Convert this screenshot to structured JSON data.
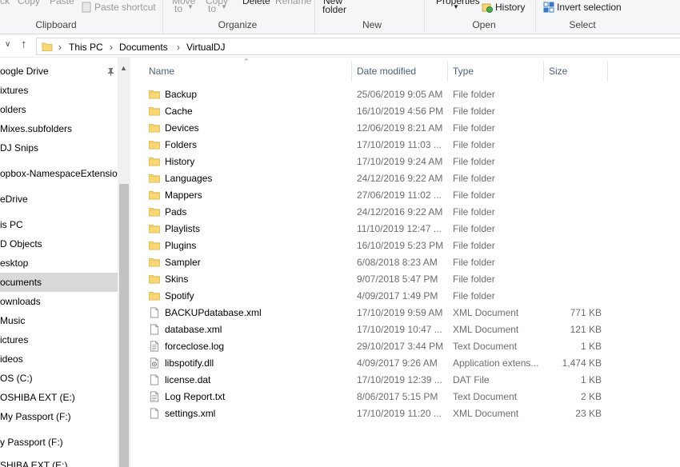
{
  "ribbon": {
    "cut_partial": "ck",
    "copy_partial": "Copy",
    "paste_partial": "Paste",
    "paste_shortcut": "Paste shortcut",
    "move_to": "Move",
    "move_to_2": "to",
    "copy_to": "Copy",
    "copy_to_2": "to",
    "delete_partial": "Delete",
    "rename_partial": "Rename",
    "new_folder_1": "New",
    "new_folder_2": "folder",
    "properties_partial": "Properties",
    "history": "History",
    "invert_selection": "Invert selection",
    "groups": {
      "clipboard": "Clipboard",
      "organize": "Organize",
      "new": "New",
      "open": "Open",
      "select": "Select"
    }
  },
  "address": {
    "crumbs": [
      "This PC",
      "Documents",
      "VirtualDJ"
    ]
  },
  "nav": {
    "items": [
      {
        "label": "oogle Drive",
        "selected": false
      },
      {
        "label": "ixtures",
        "selected": false
      },
      {
        "label": "olders",
        "selected": false
      },
      {
        "label": "Mixes.subfolders",
        "selected": false
      },
      {
        "label": "DJ Snips",
        "selected": false
      },
      {
        "label": "opbox-NamespaceExtension",
        "selected": false
      },
      {
        "label": "eDrive",
        "selected": false
      },
      {
        "label": "is PC",
        "selected": false
      },
      {
        "label": "D Objects",
        "selected": false
      },
      {
        "label": "esktop",
        "selected": false
      },
      {
        "label": "ocuments",
        "selected": true
      },
      {
        "label": "ownloads",
        "selected": false
      },
      {
        "label": "Music",
        "selected": false
      },
      {
        "label": "ictures",
        "selected": false
      },
      {
        "label": "ideos",
        "selected": false
      },
      {
        "label": "OS (C:)",
        "selected": false
      },
      {
        "label": "OSHIBA EXT (E:)",
        "selected": false
      },
      {
        "label": "My Passport (F:)",
        "selected": false
      },
      {
        "label": "y Passport (F:)",
        "selected": false
      },
      {
        "label": "SHIBA EXT (E:)",
        "selected": false
      }
    ]
  },
  "list": {
    "headers": {
      "name": "Name",
      "date": "Date modified",
      "type": "Type",
      "size": "Size"
    },
    "rows": [
      {
        "icon": "folder-icon",
        "name": "Backup",
        "date": "25/06/2019 9:05 AM",
        "type": "File folder",
        "size": ""
      },
      {
        "icon": "folder-icon",
        "name": "Cache",
        "date": "16/10/2019 4:56 PM",
        "type": "File folder",
        "size": ""
      },
      {
        "icon": "folder-icon",
        "name": "Devices",
        "date": "12/06/2019 8:21 AM",
        "type": "File folder",
        "size": ""
      },
      {
        "icon": "folder-icon",
        "name": "Folders",
        "date": "17/10/2019 11:03 ...",
        "type": "File folder",
        "size": ""
      },
      {
        "icon": "folder-icon",
        "name": "History",
        "date": "17/10/2019 9:24 AM",
        "type": "File folder",
        "size": ""
      },
      {
        "icon": "folder-icon",
        "name": "Languages",
        "date": "24/12/2016 9:22 AM",
        "type": "File folder",
        "size": ""
      },
      {
        "icon": "folder-icon",
        "name": "Mappers",
        "date": "27/06/2019 11:02 ...",
        "type": "File folder",
        "size": ""
      },
      {
        "icon": "folder-icon",
        "name": "Pads",
        "date": "24/12/2016 9:22 AM",
        "type": "File folder",
        "size": ""
      },
      {
        "icon": "folder-icon",
        "name": "Playlists",
        "date": "11/10/2019 12:47 ...",
        "type": "File folder",
        "size": ""
      },
      {
        "icon": "folder-icon",
        "name": "Plugins",
        "date": "16/10/2019 5:23 PM",
        "type": "File folder",
        "size": ""
      },
      {
        "icon": "folder-icon",
        "name": "Sampler",
        "date": "6/08/2018 8:23 AM",
        "type": "File folder",
        "size": ""
      },
      {
        "icon": "folder-icon",
        "name": "Skins",
        "date": "9/07/2018 5:47 PM",
        "type": "File folder",
        "size": ""
      },
      {
        "icon": "folder-icon",
        "name": "Spotify",
        "date": "4/09/2017 1:49 PM",
        "type": "File folder",
        "size": ""
      },
      {
        "icon": "file-icon",
        "name": "BACKUPdatabase.xml",
        "date": "17/10/2019 9:59 AM",
        "type": "XML Document",
        "size": "771 KB"
      },
      {
        "icon": "file-icon",
        "name": "database.xml",
        "date": "17/10/2019 10:47 ...",
        "type": "XML Document",
        "size": "121 KB"
      },
      {
        "icon": "text-file-icon",
        "name": "forceclose.log",
        "date": "29/10/2017 3:44 PM",
        "type": "Text Document",
        "size": "1 KB"
      },
      {
        "icon": "dll-file-icon",
        "name": "libspotify.dll",
        "date": "4/09/2017 9:26 AM",
        "type": "Application extens...",
        "size": "1,474 KB"
      },
      {
        "icon": "file-icon",
        "name": "license.dat",
        "date": "17/10/2019 12:39 ...",
        "type": "DAT File",
        "size": "1 KB"
      },
      {
        "icon": "text-file-icon",
        "name": "Log Report.txt",
        "date": "8/06/2017 5:15 PM",
        "type": "Text Document",
        "size": "2 KB"
      },
      {
        "icon": "file-icon",
        "name": "settings.xml",
        "date": "17/10/2019 11:20 ...",
        "type": "XML Document",
        "size": "23 KB"
      }
    ]
  },
  "colors": {
    "folder": "#f8d775",
    "selected_nav": "#d9d9d9",
    "header_text": "#4c607a",
    "secondary_text": "#6d6d6d"
  }
}
